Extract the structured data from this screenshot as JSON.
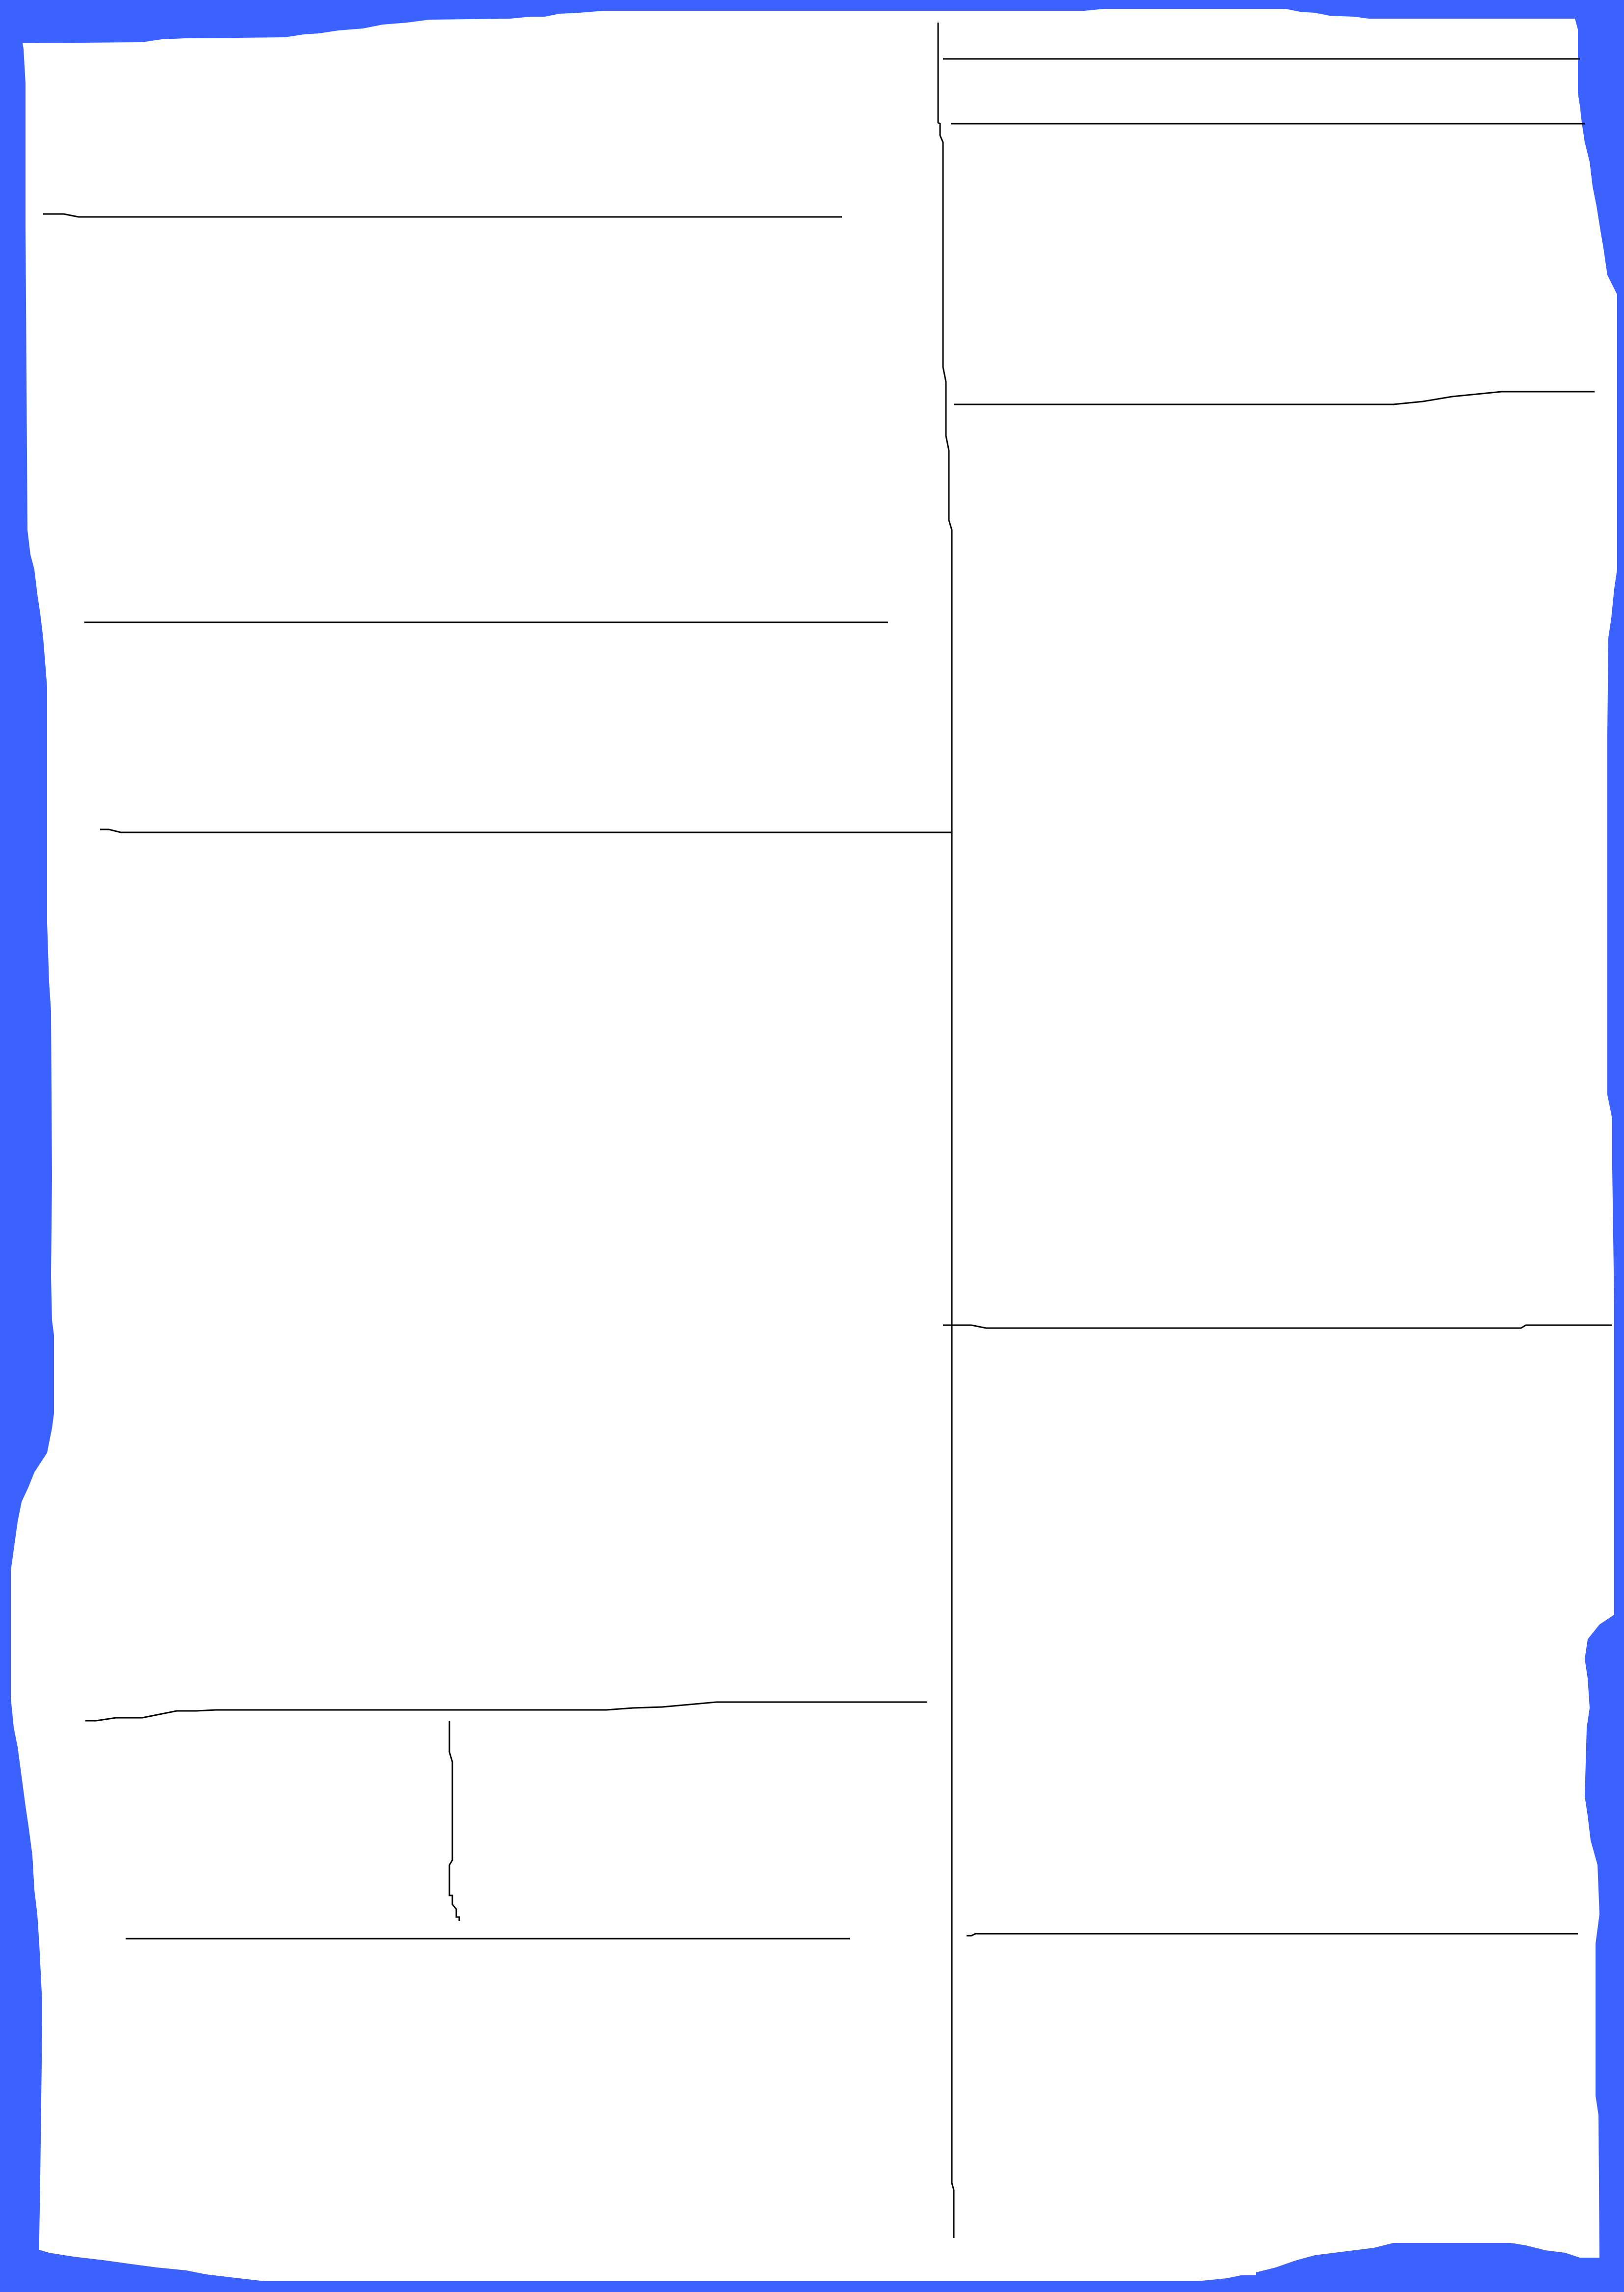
{
  "canvas": {
    "background_color": "#3b62ff",
    "paper_color": "#ffffff",
    "line_color": "#000000"
  },
  "regions": [
    {
      "name": "top-left-panel"
    },
    {
      "name": "middle-left-panel"
    },
    {
      "name": "lower-left-panel"
    },
    {
      "name": "bottom-left-panel"
    },
    {
      "name": "top-right-strip"
    },
    {
      "name": "upper-right-panel"
    },
    {
      "name": "middle-right-panel"
    },
    {
      "name": "bottom-right-panel"
    }
  ]
}
